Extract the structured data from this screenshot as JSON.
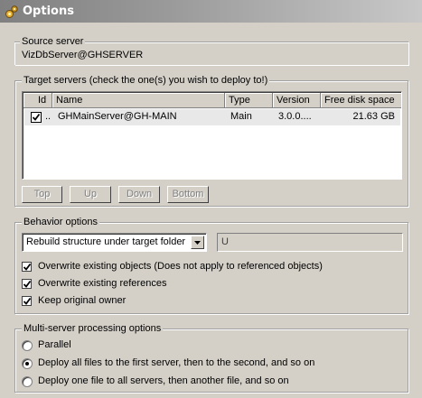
{
  "window": {
    "title": "Options",
    "icon": "gears-icon"
  },
  "source": {
    "label": "Source server",
    "value": "VizDbServer@GHSERVER"
  },
  "targets": {
    "label": "Target servers (check the one(s) you wish to deploy to!)",
    "columns": [
      "Id",
      "Name",
      "Type",
      "Version",
      "Free disk space"
    ],
    "rows": [
      {
        "checked": true,
        "id": "..",
        "name": "GHMainServer@GH-MAIN",
        "type": "Main",
        "version": "3.0.0....",
        "free": "21.63 GB"
      }
    ],
    "buttons": {
      "top": "Top",
      "up": "Up",
      "down": "Down",
      "bottom": "Bottom"
    }
  },
  "behavior": {
    "label": "Behavior options",
    "mode": "Rebuild structure under target folder",
    "folder_value": "U",
    "options": [
      {
        "label": "Overwrite existing objects (Does not apply to referenced objects)",
        "checked": true
      },
      {
        "label": "Overwrite existing references",
        "checked": true
      },
      {
        "label": "Keep original owner",
        "checked": true
      }
    ]
  },
  "multiserver": {
    "label": "Multi-server processing options",
    "options": [
      {
        "label": "Parallel",
        "selected": false
      },
      {
        "label": "Deploy all files to the first server, then to the second, and so on",
        "selected": true
      },
      {
        "label": "Deploy one file to all servers, then another file, and so on",
        "selected": false
      }
    ]
  }
}
